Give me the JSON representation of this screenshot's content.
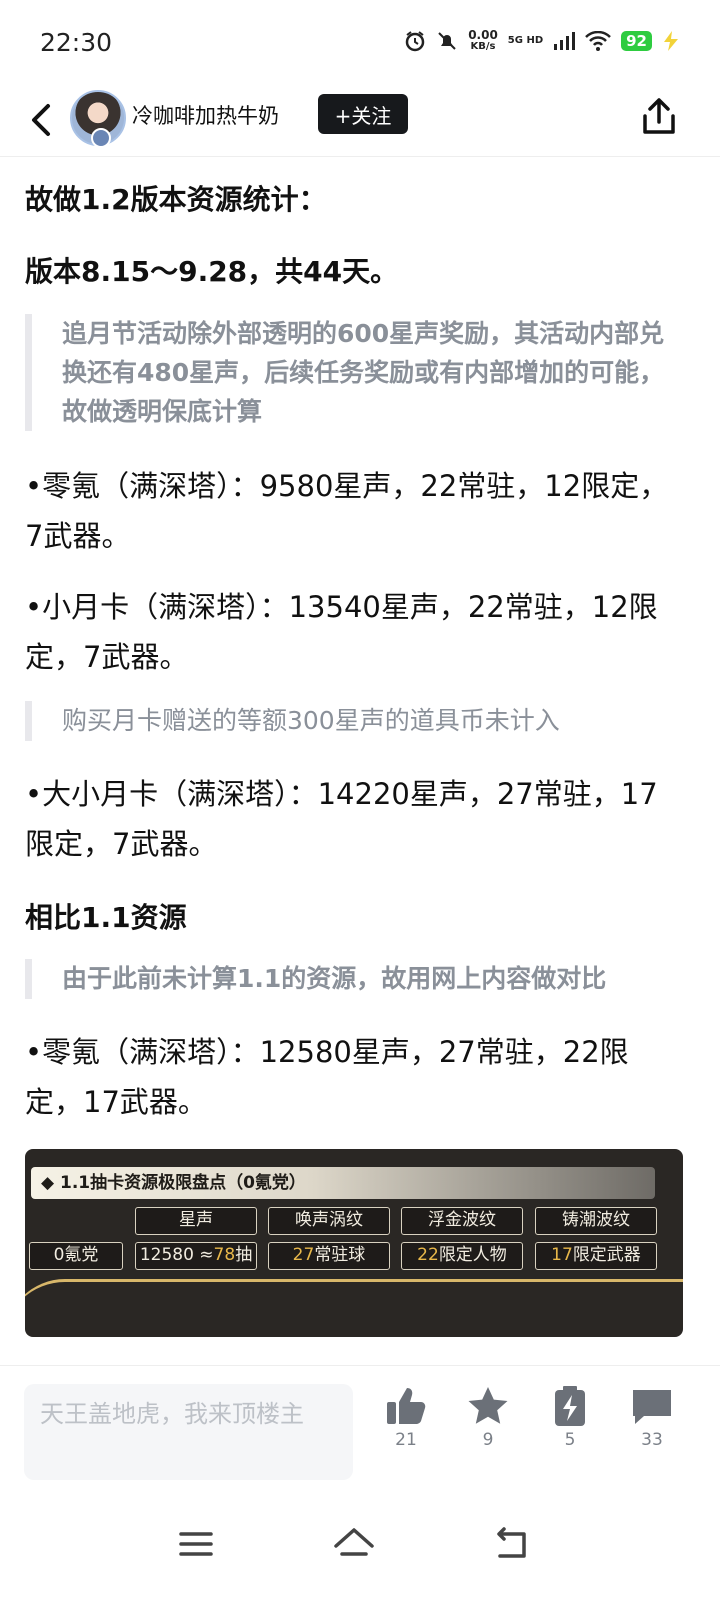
{
  "status": {
    "time": "22:30",
    "net_speed": "0.00",
    "net_unit": "KB/s",
    "network": "5G HD",
    "battery": "92",
    "battery_color": "#2ecc40"
  },
  "header": {
    "author": "冷咖啡加热牛奶",
    "follow_label": "+关注"
  },
  "article": {
    "title": "故做1.2版本资源统计：",
    "subtitle": "版本8.15～9.28，共44天。",
    "note1": "追月节活动除外部透明的600星声奖励，其活动内部兑换还有480星声，后续任务奖励或有内部增加的可能，故做透明保底计算",
    "item1": "•零氪（满深塔）：9580星声，22常驻，12限定，7武器。",
    "item2": "•小月卡（满深塔）：13540星声，22常驻，12限定，7武器。",
    "note2": "购买月卡赠送的等额300星声的道具币未计入",
    "item3": "•大小月卡（满深塔）：14220星声，27常驻，17限定，7武器。",
    "section": "相比1.1资源",
    "note3": "由于此前未计算1.1的资源，故用网上内容做对比",
    "item4": "•零氪（满深塔）：12580星声，27常驻，22限定，17武器。"
  },
  "game_image": {
    "banner": "◆ 1.1抽卡资源极限盘点（0氪党）",
    "headers": [
      "星声",
      "唤声涡纹",
      "浮金波纹",
      "铸潮波纹"
    ],
    "row_label": "0氪党",
    "cells": [
      {
        "pre": "12580 ≈",
        "num": "78",
        "post": "抽"
      },
      {
        "pre": "",
        "num": "27",
        "post": "常驻球"
      },
      {
        "pre": "",
        "num": "22",
        "post": "限定人物"
      },
      {
        "pre": "",
        "num": "17",
        "post": "限定武器"
      }
    ]
  },
  "bottom": {
    "comment_placeholder": "天王盖地虎，我来顶楼主",
    "likes": "21",
    "favorites": "9",
    "charges": "5",
    "comments": "33"
  },
  "icons": [
    "back-icon",
    "share-icon",
    "like-icon",
    "star-icon",
    "charge-icon",
    "comment-icon",
    "menu-icon",
    "home-icon",
    "return-icon"
  ]
}
